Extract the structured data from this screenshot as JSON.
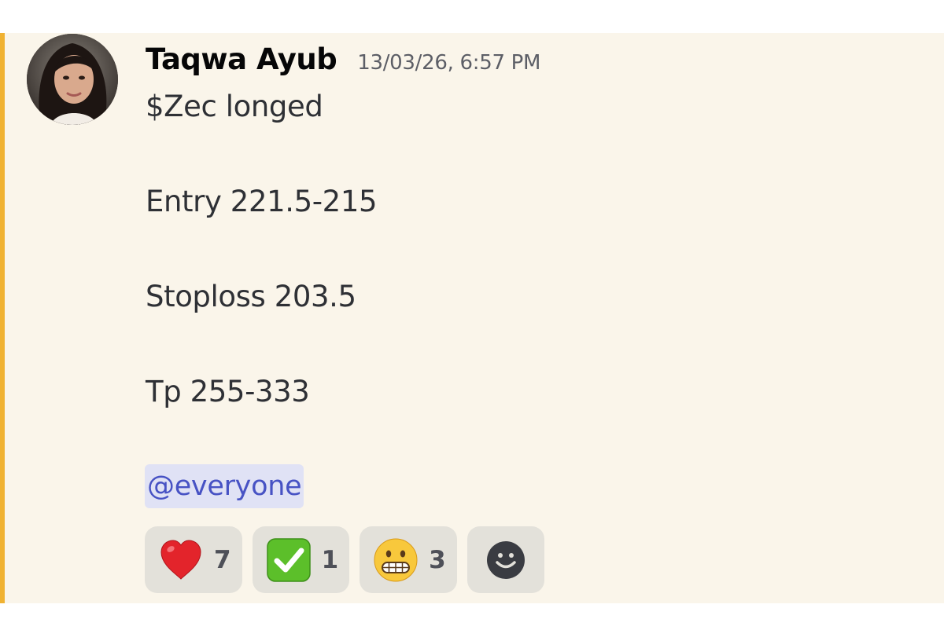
{
  "message": {
    "author": "Taqwa Ayub",
    "timestamp": "13/03/26, 6:57 PM",
    "lines": [
      "$Zec longed",
      "Entry 221.5-215",
      "Stoploss 203.5",
      "Tp 255-333"
    ],
    "mention": "@everyone"
  },
  "reactions": [
    {
      "emoji_name": "red-heart",
      "count": "7"
    },
    {
      "emoji_name": "check-mark-button",
      "count": "1"
    },
    {
      "emoji_name": "grimacing-face",
      "count": "3"
    }
  ],
  "add_reaction_icon": "smiley-face-icon",
  "colors": {
    "message_background": "#faf5ea",
    "mention_bar": "#f0b232",
    "mention_background": "#e0e2f5",
    "mention_text": "#4752c4",
    "reaction_background": "#e3e1da"
  }
}
